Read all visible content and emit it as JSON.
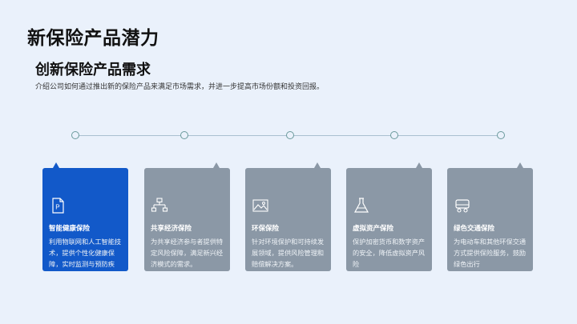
{
  "page_title": "新保险产品潜力",
  "section": {
    "title": "创新保险产品需求",
    "description": "介绍公司如何通过推出新的保险产品来满足市场需求，并进一步提高市场份额和投资回报。"
  },
  "colors": {
    "active_card": "#1259c9",
    "inactive_card": "#8b98a6",
    "background": "#eaf1fb",
    "timeline": "#a9bfd0"
  },
  "cards": [
    {
      "title": "智能健康保险",
      "description": "利用物联网和人工智能技术，提供个性化健康保障，实时监测与预防疾病。",
      "icon": "document-p-icon",
      "active": true
    },
    {
      "title": "共享经济保险",
      "description": "为共享经济参与者提供特定风险保障，满足新兴经济模式的需求。",
      "icon": "network-icon",
      "active": false
    },
    {
      "title": "环保保险",
      "description": "针对环境保护和可持续发展领域，提供风险管理和赔偿解决方案。",
      "icon": "landscape-icon",
      "active": false
    },
    {
      "title": "虚拟资产保险",
      "description": "保护加密货币和数字资产的安全，降低虚拟资产风险",
      "icon": "flask-icon",
      "active": false
    },
    {
      "title": "绿色交通保险",
      "description": "为电动车和其他环保交通方式提供保险服务，鼓励绿色出行",
      "icon": "vehicle-icon",
      "active": false
    }
  ]
}
